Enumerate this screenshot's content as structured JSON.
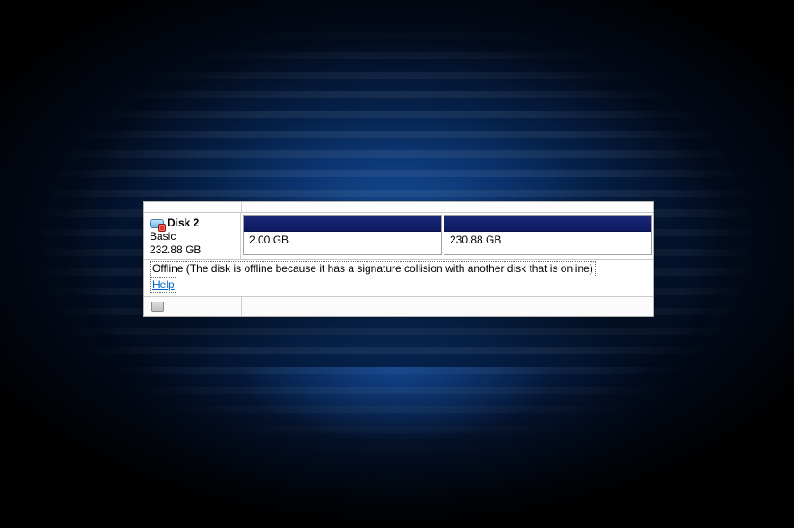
{
  "disk": {
    "name": "Disk 2",
    "type": "Basic",
    "capacity": "232.88 GB",
    "status_text": "Offline (The disk is offline because it has a signature collision with another disk that is online)",
    "help_label": "Help"
  },
  "volumes": [
    {
      "size": "2.00 GB"
    },
    {
      "size": "230.88 GB"
    }
  ]
}
